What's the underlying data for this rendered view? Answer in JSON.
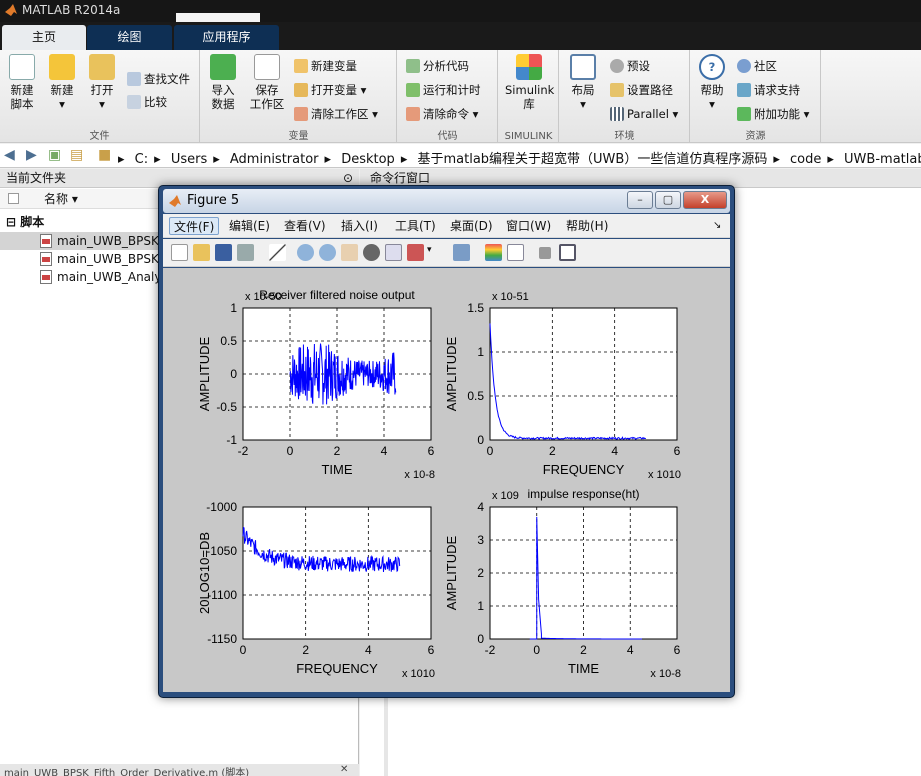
{
  "app": {
    "title": "MATLAB R2014a",
    "colors": {
      "titlebar": "#161616",
      "tab_active": "#e9ecef",
      "tab_inactive": "#0e2f54"
    }
  },
  "tabs": [
    {
      "label": "主页"
    },
    {
      "label": "绘图"
    },
    {
      "label": "应用程序"
    }
  ],
  "ribbon": {
    "file": {
      "label": "文件",
      "new_script": "新建\n脚本",
      "new": "新建",
      "open": "打开",
      "find_files": "查找文件",
      "compare": "比较"
    },
    "variable": {
      "label": "变量",
      "import": "导入\n数据",
      "save": "保存\n工作区",
      "new_var": "新建变量",
      "open_var": "打开变量",
      "clear_ws": "清除工作区"
    },
    "code": {
      "label": "代码",
      "analyze": "分析代码",
      "run_time": "运行和计时",
      "clear_cmd": "清除命令"
    },
    "simulink": {
      "label": "SIMULINK",
      "lib": "Simulink\n库"
    },
    "env": {
      "label": "环境",
      "layout": "布局",
      "prefs": "预设",
      "set_path": "设置路径",
      "parallel": "Parallel"
    },
    "resources": {
      "label": "资源",
      "help": "帮助",
      "community": "社区",
      "support": "请求支持",
      "addons": "附加功能"
    }
  },
  "address": {
    "crumbs": [
      "C:",
      "Users",
      "Administrator",
      "Desktop",
      "基于matlab编程关于超宽带（UWB）一些信道仿真程序源码",
      "code",
      "UWB-matlab-file"
    ]
  },
  "left_pane": {
    "title": "当前文件夹",
    "col_name": "名称 ▾",
    "group": "脚本",
    "files": [
      "main_UWB_BPSK_",
      "main_UWB_BPSK_",
      "main_UWB_Analys"
    ],
    "status": "main_UWB_BPSK_Fifth_Order_Derivative.m (脚本)"
  },
  "right_pane": {
    "title": "命令行窗口"
  },
  "figure": {
    "title": "Figure 5",
    "menu": [
      "文件(F)",
      "编辑(E)",
      "查看(V)",
      "插入(I)",
      "工具(T)",
      "桌面(D)",
      "窗口(W)",
      "帮助(H)"
    ],
    "arrow": "↘",
    "wbtn": {
      "min": "–",
      "max": "▢",
      "close": "X"
    }
  },
  "chart_data": [
    {
      "type": "line",
      "title": "Receiver filtered noise output",
      "xlabel": "TIME",
      "ylabel": "AMPLITUDE",
      "xlim": [
        -2,
        6
      ],
      "ylim": [
        -1,
        1
      ],
      "x_scale": "x 10^-8",
      "y_scale": "x 10^-50",
      "xticks": [
        "-2",
        "0",
        "2",
        "4",
        "6"
      ],
      "yticks": [
        "1",
        "0.5",
        "0",
        "-0.5",
        "-1"
      ],
      "series": [
        {
          "color": "#0000ff",
          "x_range": [
            0,
            4.5
          ],
          "amplitude": 0.5
        }
      ],
      "grid": true
    },
    {
      "type": "line",
      "title": "",
      "xlabel": "FREQUENCY",
      "ylabel": "AMPLITUDE",
      "xlim": [
        0,
        6
      ],
      "ylim": [
        0,
        1.5
      ],
      "x_scale": "x 10^10",
      "y_scale": "x 10^-51",
      "xticks": [
        "0",
        "2",
        "4",
        "6"
      ],
      "yticks": [
        "1.5",
        "1",
        "0.5",
        "0"
      ],
      "series": [
        {
          "color": "#0000ff",
          "x_range": [
            0,
            5
          ],
          "peak": 1.3
        }
      ],
      "grid": true
    },
    {
      "type": "line",
      "title": "",
      "xlabel": "FREQUENCY",
      "ylabel": "20LOG10=DB",
      "xlim": [
        0,
        6
      ],
      "ylim": [
        -1150,
        -1000
      ],
      "x_scale": "x 10^10",
      "y_scale": "",
      "xticks": [
        "0",
        "2",
        "4",
        "6"
      ],
      "yticks": [
        "-1000",
        "-1050",
        "-1100",
        "-1150"
      ],
      "series": [
        {
          "color": "#0000ff",
          "x_range": [
            0,
            5
          ],
          "start": -1030,
          "end": -1065
        }
      ],
      "grid": true
    },
    {
      "type": "line",
      "title": "impulse response(ht)",
      "xlabel": "TIME",
      "ylabel": "AMPLITUDE",
      "xlim": [
        -2,
        6
      ],
      "ylim": [
        0,
        4
      ],
      "x_scale": "x 10^-8",
      "y_scale": "x 10^9",
      "xticks": [
        "-2",
        "0",
        "2",
        "4",
        "6"
      ],
      "yticks": [
        "4",
        "3",
        "2",
        "1",
        "0"
      ],
      "series": [
        {
          "color": "#0000ff",
          "x_range": [
            0,
            4.5
          ],
          "peak": 3.7
        }
      ],
      "grid": true
    }
  ]
}
